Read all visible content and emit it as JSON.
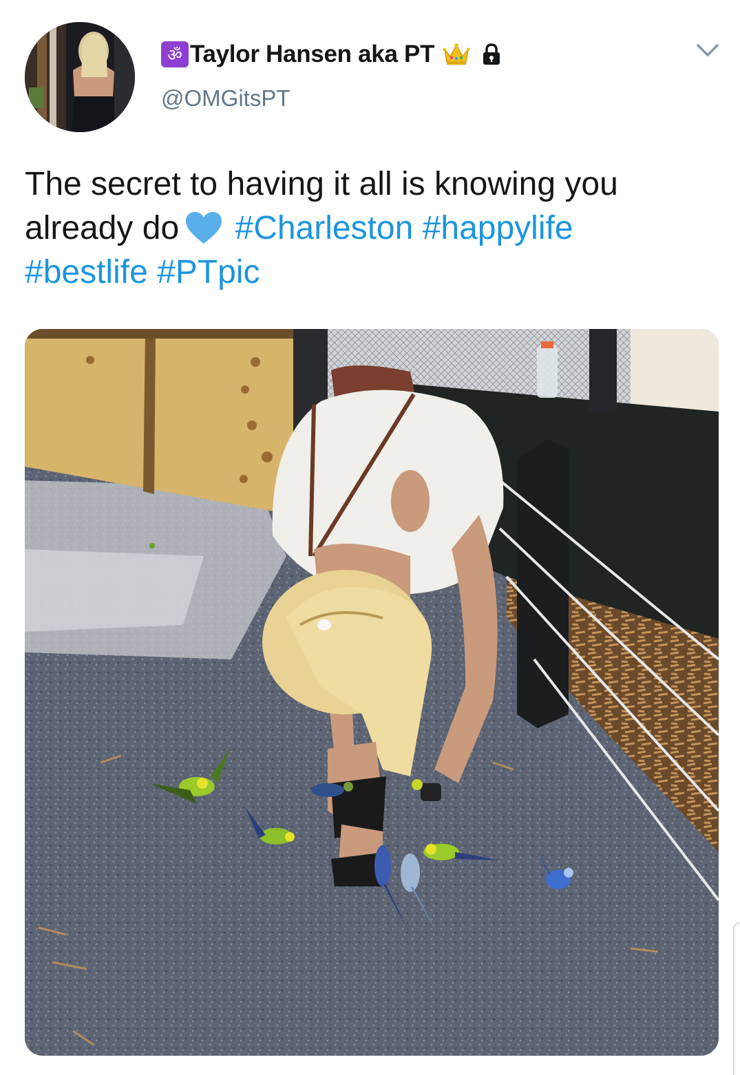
{
  "tweet": {
    "user": {
      "name_badge": "ॐ",
      "display_name": "Taylor Hansen aka PT",
      "handle": "@OMGitsPT"
    },
    "text": {
      "line1": "The secret to having it all is knowing you",
      "line2_start": "already do",
      "hashtags": [
        "#Charleston",
        "#happylife",
        "#bestlife",
        "#PTpic"
      ]
    },
    "icons": {
      "badge": "om-badge-icon",
      "crown": "crown-icon",
      "lock": "lock-icon",
      "heart": "blue-heart-icon",
      "menu": "chevron-down-icon"
    },
    "colors": {
      "hashtag": "#1b95e0",
      "handle": "#657786",
      "badge": "#8c3fd1",
      "heart": "#5aaeea"
    }
  }
}
